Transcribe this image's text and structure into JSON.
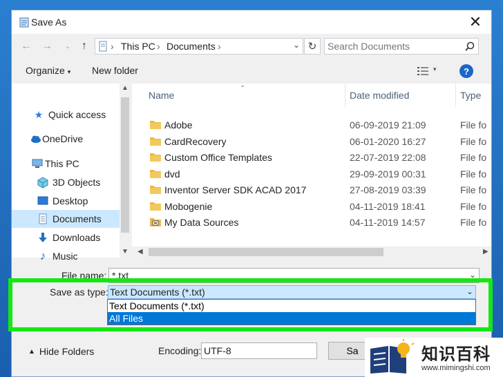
{
  "dialog": {
    "title": "Save As",
    "close": "✕"
  },
  "nav": {
    "path": [
      "This PC",
      "Documents"
    ],
    "separator": "›",
    "refresh": "↻",
    "search_placeholder": "Search Documents"
  },
  "toolbar": {
    "organize": "Organize",
    "new_folder": "New folder"
  },
  "sidebar": {
    "items": [
      {
        "label": "Quick access"
      },
      {
        "label": "OneDrive"
      },
      {
        "label": "This PC"
      },
      {
        "label": "3D Objects"
      },
      {
        "label": "Desktop"
      },
      {
        "label": "Documents"
      },
      {
        "label": "Downloads"
      },
      {
        "label": "Music"
      }
    ]
  },
  "columns": {
    "name": "Name",
    "date": "Date modified",
    "type": "Type"
  },
  "files": [
    {
      "name": "Adobe",
      "date": "06-09-2019 21:09",
      "type": "File fo"
    },
    {
      "name": "CardRecovery",
      "date": "06-01-2020 16:27",
      "type": "File fo"
    },
    {
      "name": "Custom Office Templates",
      "date": "22-07-2019 22:08",
      "type": "File fo"
    },
    {
      "name": "dvd",
      "date": "29-09-2019 00:31",
      "type": "File fo"
    },
    {
      "name": "Inventor Server SDK ACAD 2017",
      "date": "27-08-2019 03:39",
      "type": "File fo"
    },
    {
      "name": "Mobogenie",
      "date": "04-11-2019 18:41",
      "type": "File fo"
    },
    {
      "name": "My Data Sources",
      "date": "04-11-2019 14:57",
      "type": "File fo"
    }
  ],
  "form": {
    "filename_label": "File name:",
    "filename_value": "*.txt",
    "savetype_label": "Save as type:",
    "savetype_value": "Text Documents (*.txt)",
    "options": [
      "Text Documents (*.txt)",
      "All Files"
    ],
    "hide_folders": "Hide Folders",
    "encoding_label": "Encoding:",
    "encoding_value": "UTF-8",
    "save_button": "Sa"
  },
  "watermark": {
    "text": "知识百科",
    "url": "www.mimingshi.com"
  },
  "colors": {
    "highlight": "#13e813",
    "selection": "#0078d7",
    "sidebar_selected": "#cce8ff",
    "folder": "#e8b94a"
  }
}
